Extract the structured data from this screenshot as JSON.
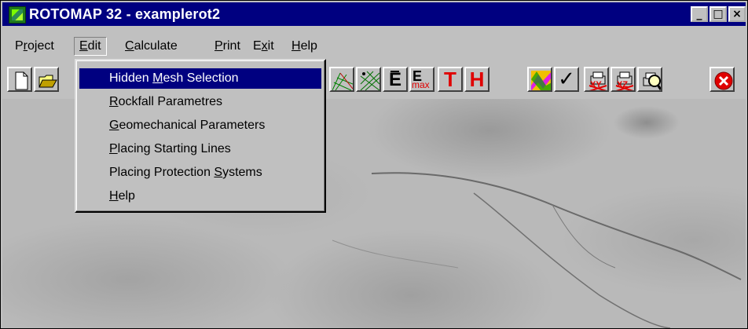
{
  "window": {
    "title": "ROTOMAP 32 - examplerot2",
    "app_icon": "rotomap-app-icon",
    "controls": {
      "minimize": "_",
      "maximize": "□",
      "close": "×"
    }
  },
  "menubar": {
    "items": [
      {
        "label_pre": "P",
        "label_u": "r",
        "label_post": "oject"
      },
      {
        "label_pre": "",
        "label_u": "E",
        "label_post": "dit"
      },
      {
        "label_pre": "",
        "label_u": "C",
        "label_post": "alculate"
      },
      {
        "label_pre": "",
        "label_u": "P",
        "label_post": "rint"
      },
      {
        "label_pre": "E",
        "label_u": "x",
        "label_post": "it"
      },
      {
        "label_pre": "",
        "label_u": "H",
        "label_post": "elp"
      }
    ]
  },
  "edit_menu": {
    "items": [
      {
        "label_pre": "Hidden ",
        "label_u": "M",
        "label_post": "esh Selection"
      },
      {
        "label_pre": "",
        "label_u": "R",
        "label_post": "ockfall Parametres"
      },
      {
        "label_pre": "",
        "label_u": "G",
        "label_post": "eomechanical Parameters"
      },
      {
        "label_pre": "",
        "label_u": "P",
        "label_post": "lacing Starting Lines"
      },
      {
        "label_pre": "Placing Protection ",
        "label_u": "S",
        "label_post": "ystems"
      },
      {
        "label_pre": "",
        "label_u": "H",
        "label_post": "elp"
      }
    ]
  },
  "toolbar": {
    "icons": [
      "new-file-icon",
      "open-folder-icon",
      "mesh-view-icon",
      "mesh-select-icon",
      "energy-icon",
      "energy-max-icon",
      "T-letter-icon",
      "H-letter-icon",
      "colored-map-icon",
      "checkmark-icon",
      "print-xy-icon",
      "print-xz-icon",
      "print-preview-icon",
      "close-app-icon"
    ],
    "labels": {
      "E": "E",
      "Emax_E": "E",
      "Emax_sub": "max",
      "T": "T",
      "H": "H",
      "check": "✓",
      "xy": "XY",
      "xz": "XZ"
    }
  },
  "colors": {
    "titlebar": "#000080",
    "face": "#c0c0c0",
    "selection": "#000080",
    "red_letters": "#e00000"
  }
}
